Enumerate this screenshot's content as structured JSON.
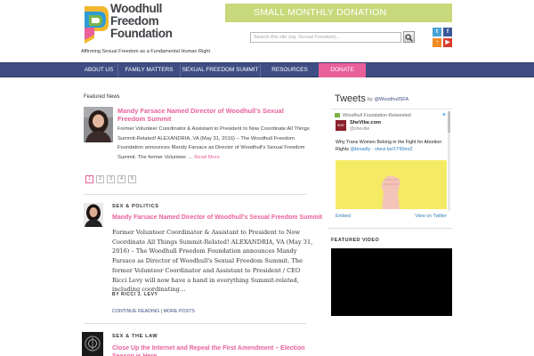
{
  "header": {
    "logo_lines": [
      "Woodhull",
      "Freedom",
      "Foundation"
    ],
    "tagline": "Affirming Sexual Freedom as a Fundamental Human Right",
    "donate_banner": "SMALL MONTHLY DONATION",
    "search_placeholder": "Search this site (eg. Sexual Freedom)...",
    "social_icons": [
      {
        "name": "twitter-icon",
        "glyph": "t",
        "color": "#4aa3d6"
      },
      {
        "name": "facebook-icon",
        "glyph": "f",
        "color": "#3b5998"
      },
      {
        "name": "rss-icon",
        "glyph": "◔",
        "color": "#f08a24"
      },
      {
        "name": "youtube-icon",
        "glyph": "▶",
        "color": "#d83b2b"
      }
    ]
  },
  "nav": {
    "items": [
      {
        "label": "ABOUT US"
      },
      {
        "label": "FAMILY MATTERS"
      },
      {
        "label": "SEXUAL FREEDOM SUMMIT"
      },
      {
        "label": "RESOURCES"
      },
      {
        "label": "DONATE"
      }
    ]
  },
  "featured": {
    "heading": "Featured News",
    "title": "Mandy Farsace Named Director of Woodhull's Sexual Freedom Summit",
    "excerpt": "Former Volunteer Coordinator & Assistant to President to Now Coordinate All Things Summit-Related! ALEXANDRIA, VA (May 31, 2016) – The Woodhull Freedom Foundation announces Mandy Farsace as Director of Woodhull's Sexual Freedom Summit. The former Volunteer …",
    "read_more": "Read More",
    "pages": [
      "1",
      "2",
      "3",
      "4",
      "5"
    ],
    "current_page": "1"
  },
  "posts": [
    {
      "category": "SEX & POLITICS",
      "title": "Mandy Farsace Named Director of Woodhull's Sexual Freedom Summit",
      "excerpt": "Former Volunteer Coordinator & Assistant to President to Now Coordinate All Things Summit-Related! ALEXANDRIA, VA (May 31, 2016) – The Woodhull Freedom Foundation announces Mandy Farsace as Director of Woodhull's Sexual Freedom Summit. The former Volunteer Coordinator and Assistant to President / CEO Ricci Levy will now have a hand in everything Summit-related, including coordinating…",
      "author": "BY RICCI J. LEVY",
      "continue_label": "CONTINUE READING",
      "separator": "|",
      "more_label": "MORE POSTS"
    },
    {
      "category": "SEX & THE LAW",
      "title": "Close Up the Internet and Repeal the First Amendment – Election Season is Here"
    }
  ],
  "tweets": {
    "title": "Tweets",
    "by_prefix": "by",
    "handle": "@WoodhullSFA",
    "retweet_line": "Woodhull Foundation Retweeted",
    "account_name": "SheVibe.com",
    "account_handle": "@shevibe",
    "avatar_text": "SHE",
    "text": "Why Trans Women Belong in the Fight for Abortion Rights",
    "text_links": "@broadly · shevi.be/1Y90noZ",
    "embed_label": "Embed",
    "view_label": "View on Twitter"
  },
  "video": {
    "heading": "FEATURED VIDEO"
  }
}
